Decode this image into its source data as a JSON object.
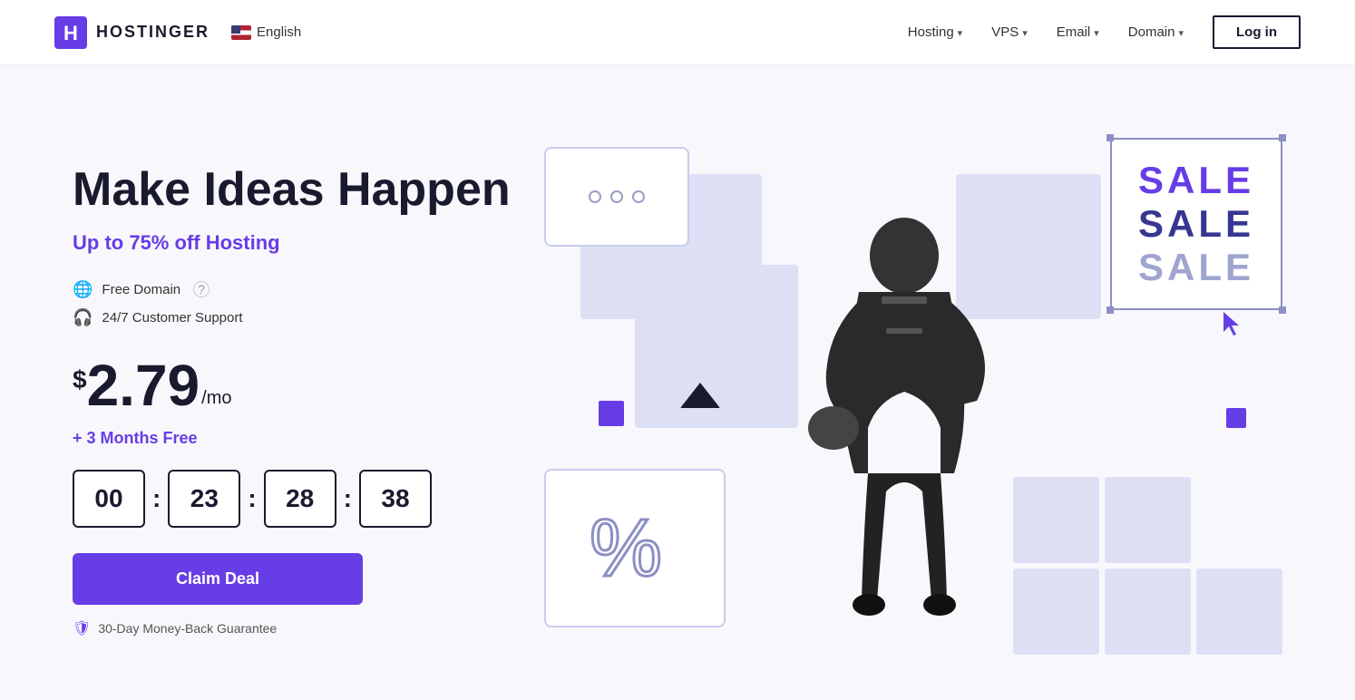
{
  "nav": {
    "logo_text": "HOSTINGER",
    "lang": "English",
    "links": [
      {
        "label": "Hosting",
        "id": "hosting"
      },
      {
        "label": "VPS",
        "id": "vps"
      },
      {
        "label": "Email",
        "id": "email"
      },
      {
        "label": "Domain",
        "id": "domain"
      }
    ],
    "login_label": "Log in"
  },
  "hero": {
    "title": "Make Ideas Happen",
    "subtitle_prefix": "Up to ",
    "subtitle_highlight": "75%",
    "subtitle_suffix": " off Hosting",
    "features": [
      {
        "icon": "globe-icon",
        "text": "Free Domain"
      },
      {
        "icon": "headset-icon",
        "text": "24/7 Customer Support"
      }
    ],
    "price_dollar": "$",
    "price_amount": "2.79",
    "price_period": "/mo",
    "months_free": "+ 3 Months Free",
    "countdown": {
      "hours": "00",
      "minutes": "23",
      "seconds": "28",
      "centiseconds": "38"
    },
    "cta_label": "Claim Deal",
    "guarantee": "30-Day Money-Back Guarantee"
  },
  "sale_graphic": {
    "sale1": "SALE",
    "sale2": "SALE",
    "sale3": "SALE"
  },
  "colors": {
    "accent": "#673de6",
    "dark": "#1a1a2e",
    "light_bg": "#dde0f5"
  }
}
